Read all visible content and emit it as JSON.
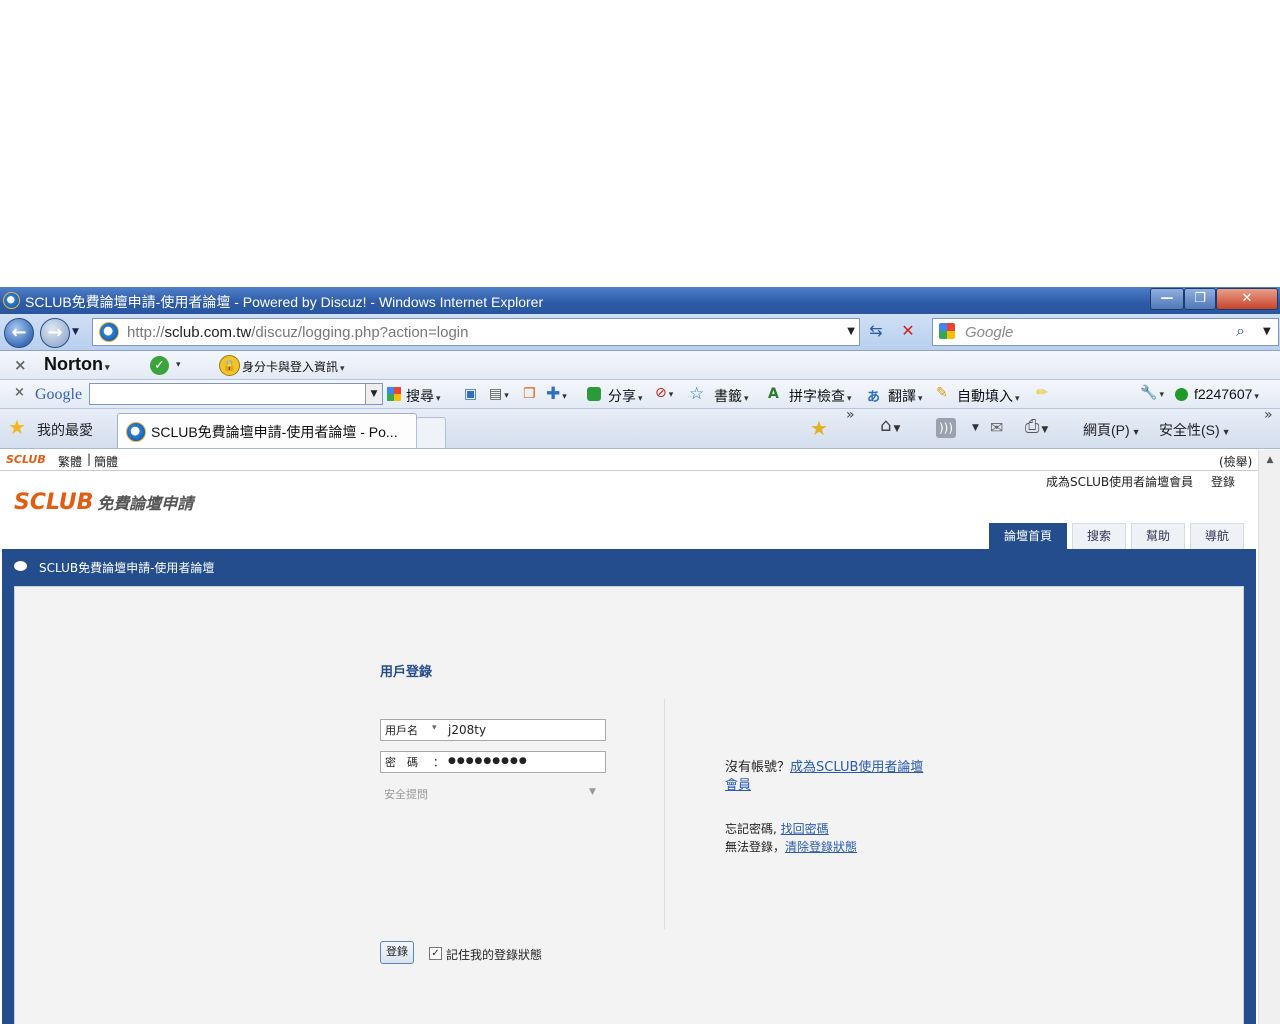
{
  "window": {
    "title": "SCLUB免費論壇申請-使用者論壇 - Powered by Discuz! - Windows Internet Explorer",
    "min": "—",
    "max": "❐",
    "close": "✕"
  },
  "address": {
    "url_prefix": "http://",
    "url_host": "sclub.com.tw",
    "url_path": "/discuz/logging.php?action=login",
    "search_placeholder": "Google"
  },
  "norton": {
    "brand": "Norton",
    "identity": "身分卡與登入資訊"
  },
  "google_bar": {
    "brand": "Google",
    "search": "搜尋",
    "share": "分享",
    "bookmarks": "書籤",
    "spellcheck": "拼字檢查",
    "translate": "翻譯",
    "autofill": "自動填入",
    "user": "f2247607"
  },
  "tabs_bar": {
    "favorites": "我的最愛",
    "active_tab": "SCLUB免費論壇申請-使用者論壇 - Po...",
    "page_menu": "網頁(P)",
    "safety_menu": "安全性(S)"
  },
  "site": {
    "top_logo": "SCLUB",
    "lang_trad": "繁體",
    "lang_simp": "簡體",
    "report": "(檢舉)",
    "register_link": "成為SCLUB使用者論壇會員",
    "login_link": "登錄",
    "logo_main": "SCLUB",
    "logo_sub": "免費論壇申請",
    "nav": [
      "論壇首頁",
      "搜索",
      "幫助",
      "導航"
    ],
    "breadcrumb": "SCLUB免費論壇申請-使用者論壇"
  },
  "login": {
    "heading": "用戶登錄",
    "username_label": "用戶名",
    "username_value": "j208ty",
    "password_label": "密　碼",
    "password_colon": "：",
    "password_value": "●●●●●●●●●",
    "security_question": "安全提問",
    "no_account": "沒有帳號？",
    "register": "成為SCLUB使用者論壇會員",
    "forgot": "忘記密碼,",
    "recover": "找回密碼",
    "cant_login": "無法登錄，",
    "clear_status": "清除登錄狀態",
    "submit": "登錄",
    "remember": "記住我的登錄狀態"
  }
}
